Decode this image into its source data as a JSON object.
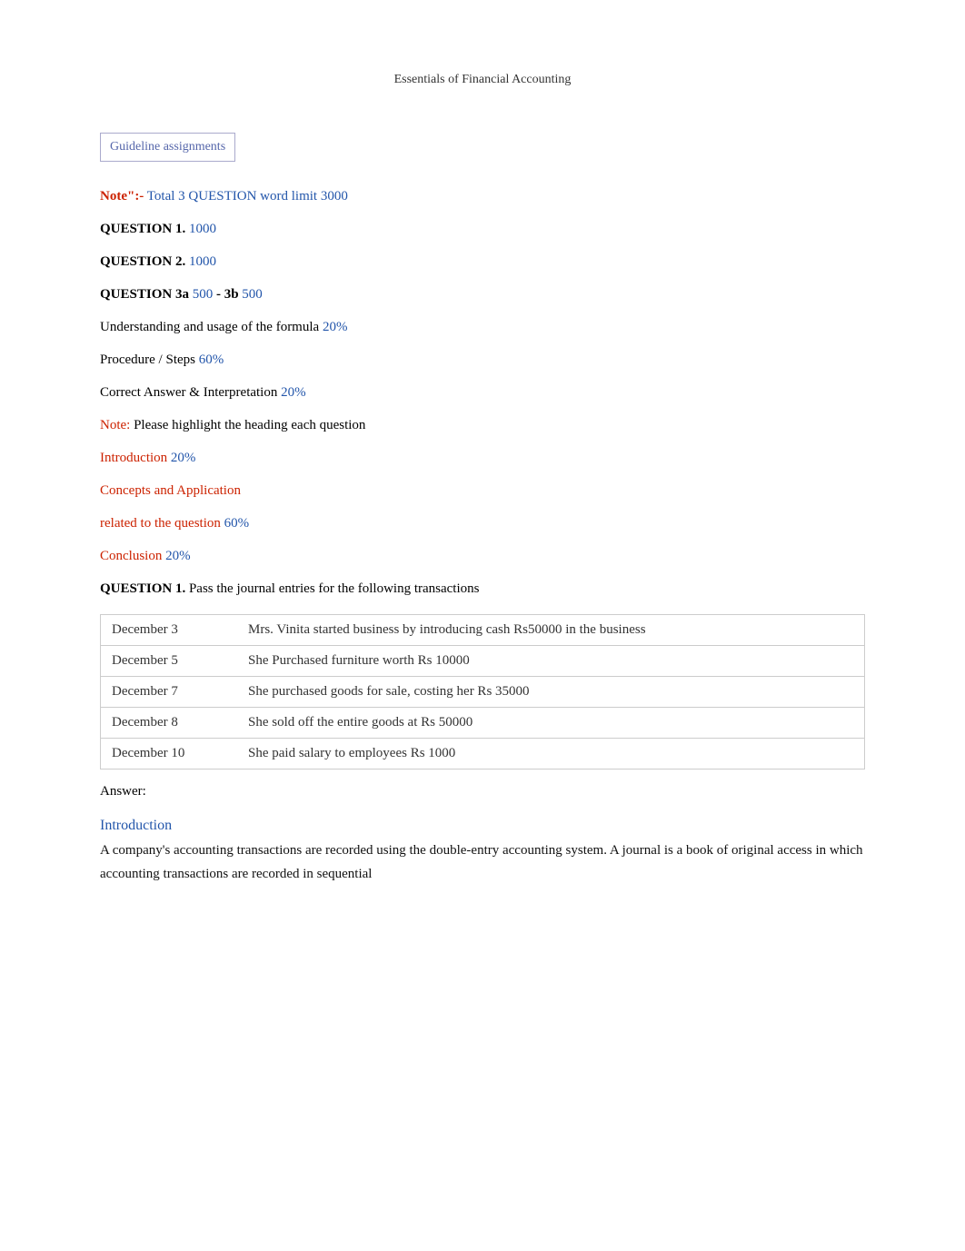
{
  "header": {
    "title": "Essentials of Financial Accounting"
  },
  "guideline": {
    "label": "Guideline assignments"
  },
  "note1": {
    "prefix": "Note\":-",
    "content": "Total 3 QUESTION",
    "separator": "   ",
    "wordlimit": "word limit 3000"
  },
  "questions": [
    {
      "label": "QUESTION 1.",
      "words": "1000"
    },
    {
      "label": "QUESTION 2.",
      "words": "1000"
    },
    {
      "label": "QUESTION 3a",
      "words1": "500",
      "sep": "- 3b",
      "words2": "500"
    }
  ],
  "criteria": [
    {
      "text": "Understanding and usage of the formula",
      "pct": "20%"
    },
    {
      "text": "Procedure / Steps",
      "pct": "60%"
    },
    {
      "text": "Correct Answer & Interpretation",
      "pct": "20%"
    }
  ],
  "note2": {
    "prefix": "Note:",
    "content": " Please highlight the heading each question"
  },
  "structure": {
    "introduction": {
      "label": "Introduction",
      "pct": "20%"
    },
    "concepts": {
      "label": "Concepts and Application"
    },
    "related": {
      "label": "related to the question",
      "pct": "60%"
    },
    "conclusion": {
      "label": "Conclusion",
      "pct": "20%"
    }
  },
  "question1": {
    "label": "QUESTION 1.",
    "text": " Pass the journal entries for the following transactions"
  },
  "table": {
    "rows": [
      {
        "date": "December 3",
        "description": "Mrs. Vinita started business by introducing cash Rs50000 in the business"
      },
      {
        "date": "December 5",
        "description": "She Purchased furniture worth Rs 10000"
      },
      {
        "date": "December 7",
        "description": "She purchased goods for sale, costing her Rs 35000"
      },
      {
        "date": "December 8",
        "description": "She sold off the entire goods at Rs 50000"
      },
      {
        "date": "December 10",
        "description": "She paid salary to employees Rs 1000"
      }
    ]
  },
  "answer": {
    "label": "Answer:",
    "intro_heading": "Introduction",
    "body": "A company's accounting transactions are recorded using the double-entry accounting system. A journal is a book of original access in which accounting transactions are recorded in sequential"
  }
}
